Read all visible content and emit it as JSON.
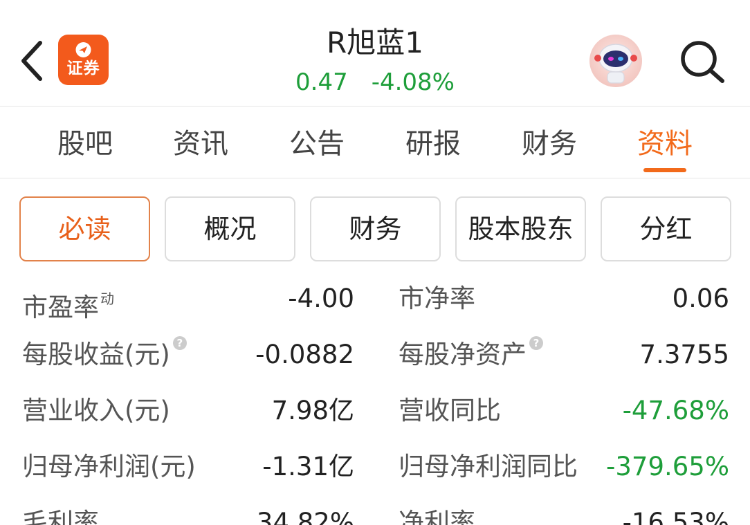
{
  "header": {
    "logo_text": "证券",
    "title": "R旭蓝1",
    "price": "0.47",
    "change_pct": "-4.08%"
  },
  "tabs": [
    {
      "label": "股吧"
    },
    {
      "label": "资讯"
    },
    {
      "label": "公告"
    },
    {
      "label": "研报"
    },
    {
      "label": "财务"
    },
    {
      "label": "资料",
      "active": true
    }
  ],
  "subtabs": [
    {
      "label": "必读",
      "active": true
    },
    {
      "label": "概况"
    },
    {
      "label": "财务"
    },
    {
      "label": "股本股东"
    },
    {
      "label": "分红"
    }
  ],
  "metrics": {
    "pe": {
      "label": "市盈率",
      "sup": "动",
      "value": "-4.00"
    },
    "pb": {
      "label": "市净率",
      "value": "0.06"
    },
    "eps": {
      "label": "每股收益(元)",
      "help": "?",
      "value": "-0.0882"
    },
    "bvps": {
      "label": "每股净资产",
      "help": "?",
      "value": "7.3755"
    },
    "revenue": {
      "label": "营业收入(元)",
      "value": "7.98亿"
    },
    "revenue_yoy": {
      "label": "营收同比",
      "value": "-47.68%"
    },
    "net_profit": {
      "label": "归母净利润(元)",
      "value": "-1.31亿"
    },
    "net_profit_yoy": {
      "label": "归母净利润同比",
      "value": "-379.65%"
    },
    "gross_margin": {
      "label": "毛利率",
      "value": "34.82%"
    },
    "net_margin": {
      "label": "净利率",
      "value": "-16.53%"
    }
  },
  "colors": {
    "accent": "#f26a1b",
    "up_down_green": "#1e9e3a",
    "logo_bg": "#f35a1c"
  },
  "icons": [
    "back-arrow-icon",
    "securities-logo-icon",
    "robot-assistant-icon",
    "search-icon",
    "help-icon"
  ]
}
